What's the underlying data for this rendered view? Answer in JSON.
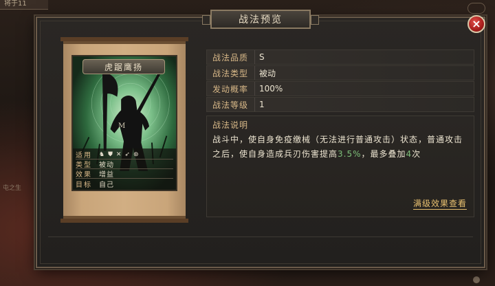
{
  "background": {
    "top_tab_text": "将于11",
    "left_text": "屯之生"
  },
  "dialog": {
    "title": "战法预览",
    "close_glyph": "×"
  },
  "card": {
    "name": "虎踞鹰扬",
    "grade": "M",
    "troop_key": "适用",
    "troop_icons": [
      "骑",
      "盾",
      "弓",
      "枪",
      "器"
    ],
    "type_key": "类型",
    "type_val": "被动",
    "effect_key": "效果",
    "effect_val": "增益",
    "target_key": "目标",
    "target_val": "自己"
  },
  "details": [
    {
      "key": "战法品质",
      "value": "S"
    },
    {
      "key": "战法类型",
      "value": "被动"
    },
    {
      "key": "发动概率",
      "value": "100%"
    },
    {
      "key": "战法等级",
      "value": "1"
    }
  ],
  "description": {
    "title": "战法说明",
    "text_before": "战斗中，使自身免疫缴械（无法进行普通攻击）状态，普通攻击之后，使自身造成兵刃伤害提高",
    "highlight_pct": "3.5%",
    "text_mid": "，最多叠加",
    "highlight_count": "4",
    "text_after": "次",
    "link": "满级效果查看"
  },
  "colors": {
    "accent_gold": "#d8b888",
    "highlight_green": "#7ec07a",
    "link": "#e8c070",
    "close_red": "#c0302c"
  }
}
